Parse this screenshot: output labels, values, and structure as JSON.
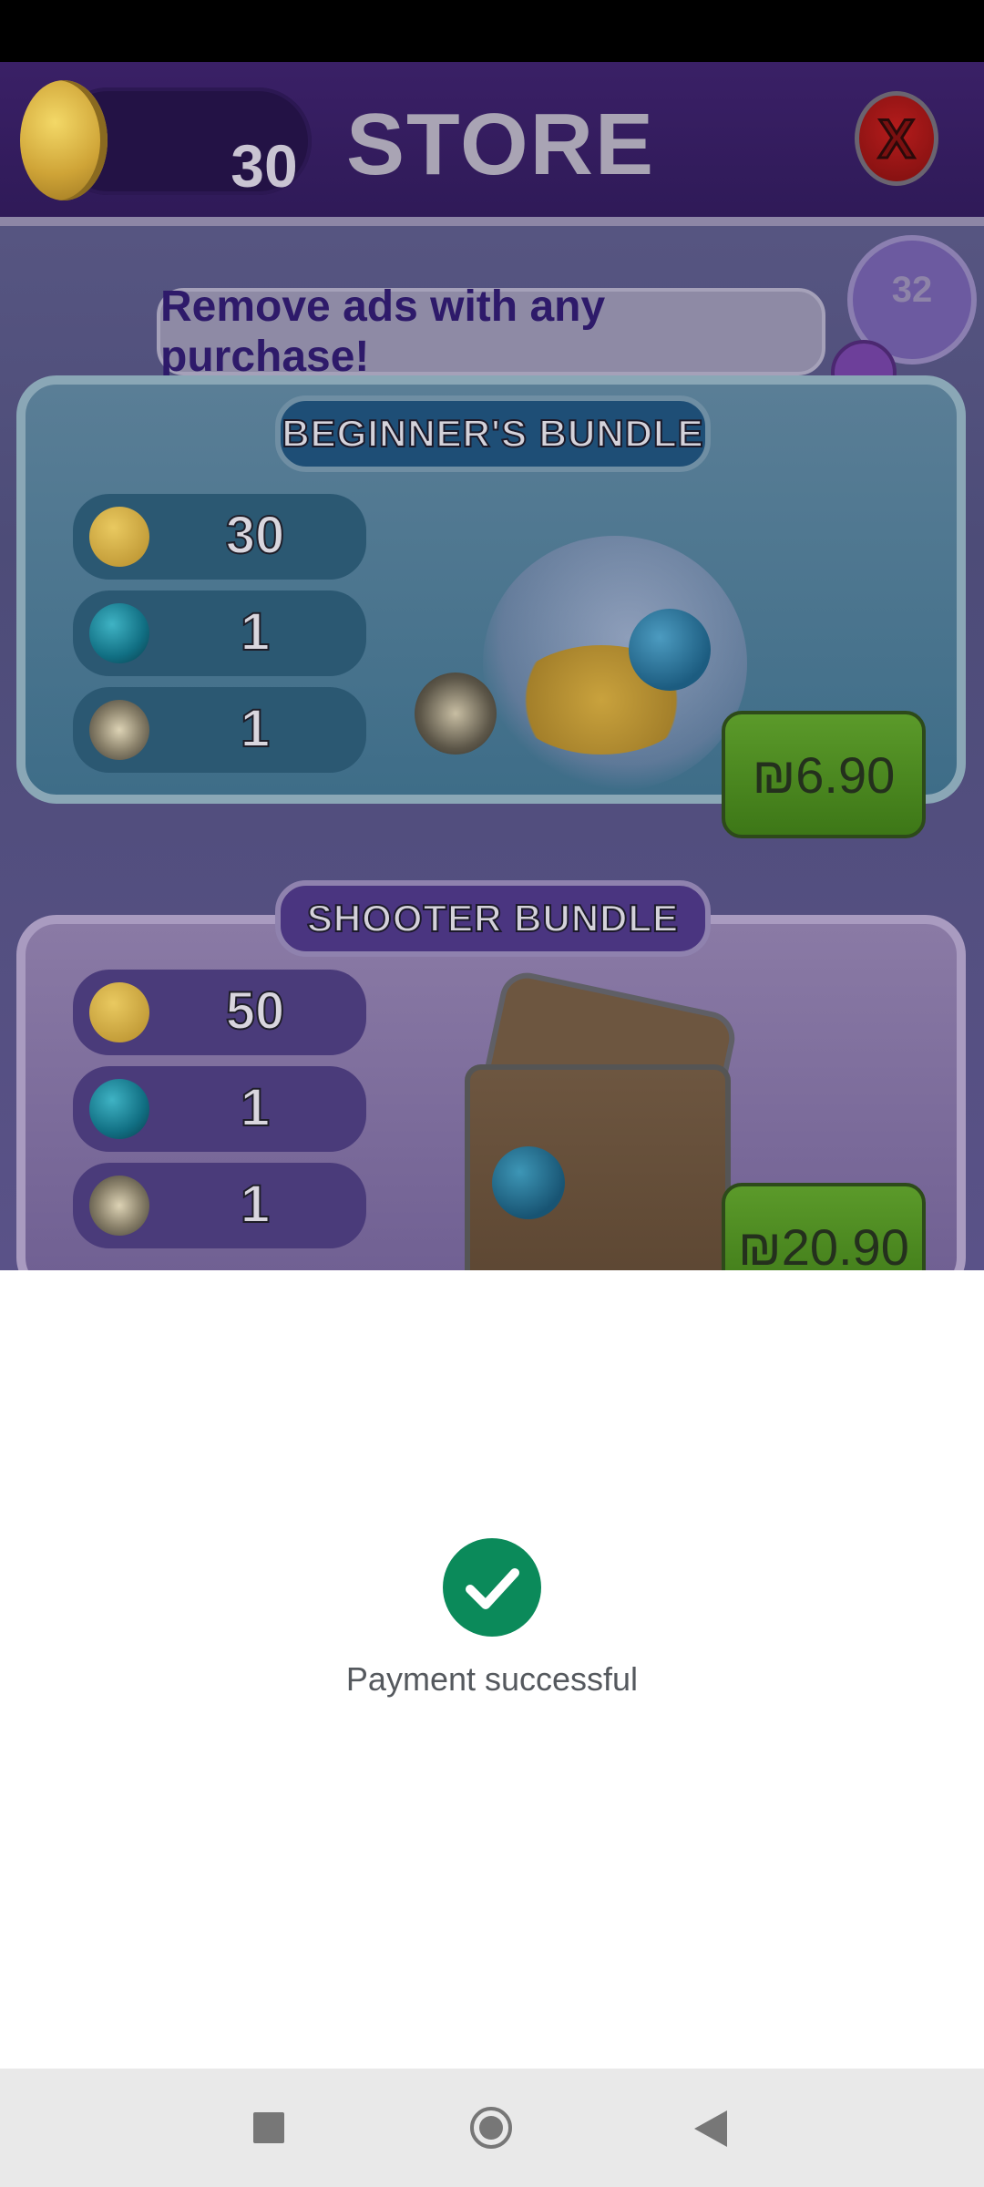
{
  "store": {
    "coin_count": "30",
    "title": "STORE",
    "close_label": "X",
    "deco_number": "32",
    "banner": "Remove ads with any purchase!"
  },
  "bundles": [
    {
      "title": "BEGINNER'S BUNDLE",
      "items": [
        {
          "icon": "coin-icon",
          "value": "30"
        },
        {
          "icon": "orb-icon",
          "value": "1"
        },
        {
          "icon": "bomb-icon",
          "value": "1"
        }
      ],
      "price": "₪6.90"
    },
    {
      "title": "SHOOTER BUNDLE",
      "items": [
        {
          "icon": "coin-icon",
          "value": "50"
        },
        {
          "icon": "orb-icon",
          "value": "1"
        },
        {
          "icon": "bomb-icon",
          "value": "1"
        }
      ],
      "price": "₪20.90"
    }
  ],
  "payment": {
    "icon": "check-circle-icon",
    "message": "Payment successful",
    "accent": "#0b8a5a"
  },
  "nav": {
    "recents": "square-icon",
    "home": "circle-icon",
    "back": "triangle-back-icon"
  }
}
